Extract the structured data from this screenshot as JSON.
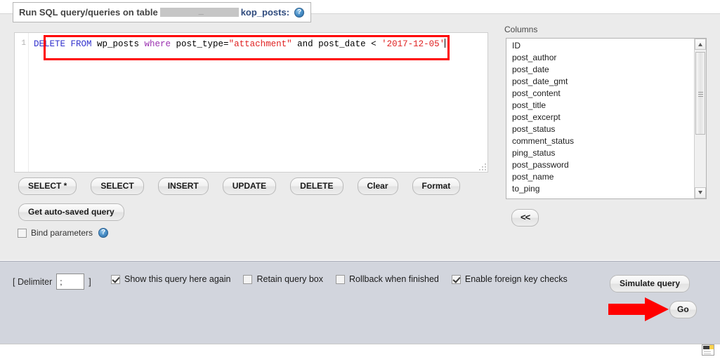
{
  "header": {
    "title_prefix": "Run SQL query/queries on table",
    "table_name_suffix": "kop_posts:",
    "help_icon": "help-circle-icon"
  },
  "editor": {
    "line_number": "1",
    "query_full": "DELETE FROM wp_posts where post_type=\"attachment\" and post_date < '2017-12-05'",
    "tokens": {
      "t1": "DELETE FROM",
      "t2": " wp_posts ",
      "t3": "where",
      "t4": " post_type=",
      "t5": "\"attachment\"",
      "t6": " and post_date ",
      "t7": "<",
      "t8": " '2017-12-05'"
    },
    "annotation_color": "#ff0000"
  },
  "query_buttons": [
    {
      "label": "SELECT *",
      "name": "select-star-button"
    },
    {
      "label": "SELECT",
      "name": "select-button"
    },
    {
      "label": "INSERT",
      "name": "insert-button"
    },
    {
      "label": "UPDATE",
      "name": "update-button"
    },
    {
      "label": "DELETE",
      "name": "delete-button"
    },
    {
      "label": "Clear",
      "name": "clear-button"
    },
    {
      "label": "Format",
      "name": "format-button"
    }
  ],
  "auto_saved_button": "Get auto-saved query",
  "bind_parameters": {
    "label": "Bind parameters",
    "checked": false,
    "help_icon": "help-circle-icon"
  },
  "columns_panel": {
    "label": "Columns",
    "items": [
      "ID",
      "post_author",
      "post_date",
      "post_date_gmt",
      "post_content",
      "post_title",
      "post_excerpt",
      "post_status",
      "comment_status",
      "ping_status",
      "post_password",
      "post_name",
      "to_ping"
    ],
    "insert_button": "<<"
  },
  "footer": {
    "delimiter_open": "[ Delimiter",
    "delimiter_value": ";",
    "delimiter_close": "]",
    "options": [
      {
        "label": "Show this query here again",
        "checked": true,
        "name": "show-query-again-checkbox"
      },
      {
        "label": "Retain query box",
        "checked": false,
        "name": "retain-query-box-checkbox"
      },
      {
        "label": "Rollback when finished",
        "checked": false,
        "name": "rollback-when-finished-checkbox"
      },
      {
        "label": "Enable foreign key checks",
        "checked": true,
        "name": "enable-foreign-key-checks-checkbox"
      }
    ],
    "simulate_label": "Simulate query",
    "go_label": "Go"
  },
  "colors": {
    "page_bg": "#ebebeb",
    "footer_bg": "#d2d5dd",
    "annotation_red": "#ff0000",
    "keyword_blue": "#3232cd",
    "keyword_purple": "#9b30b0",
    "string_red": "#e02020"
  },
  "console_icon": "console-window-icon"
}
